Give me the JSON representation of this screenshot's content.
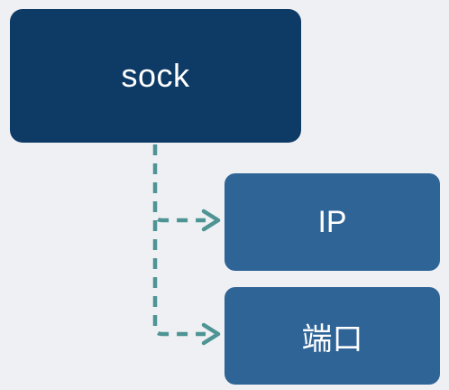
{
  "diagram": {
    "root": {
      "label": "sock"
    },
    "children": [
      {
        "label": "IP"
      },
      {
        "label": "端口"
      }
    ],
    "colors": {
      "background": "#eff0f3",
      "root_fill": "#0d3b66",
      "child_fill": "#2f6497",
      "connector": "#4e9494",
      "text": "#ffffff"
    },
    "connector_style": "dashed-arrow"
  }
}
